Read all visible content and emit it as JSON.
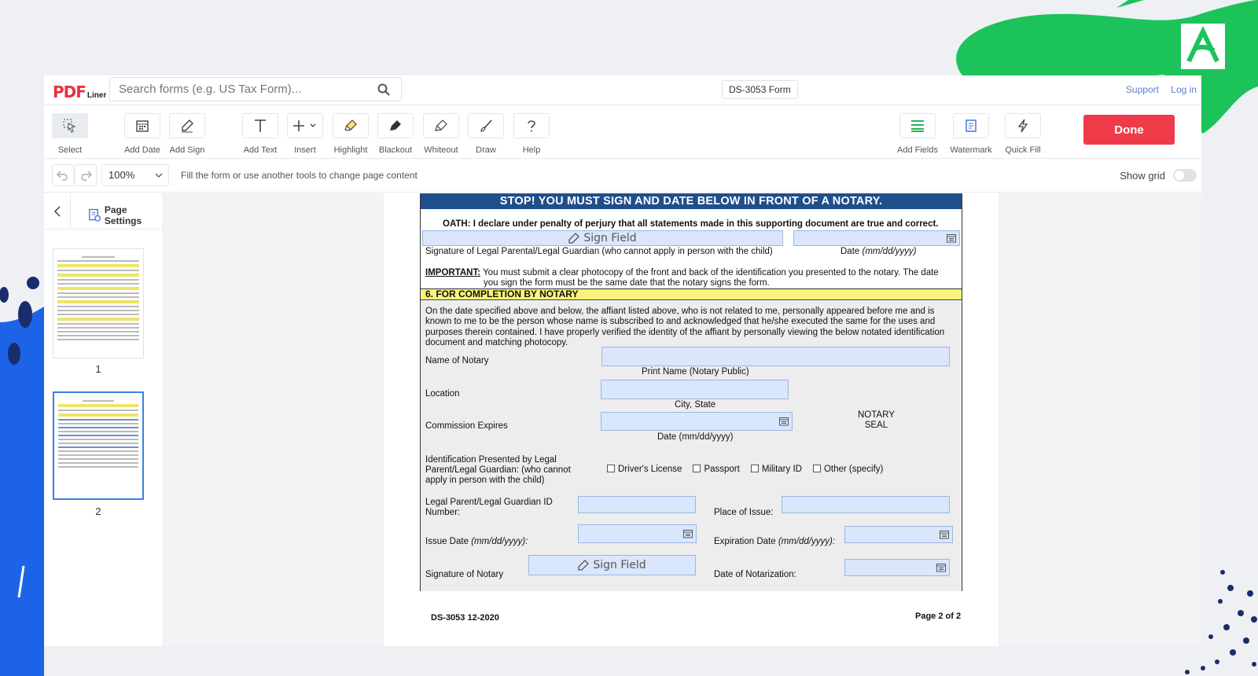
{
  "header": {
    "logo_main": "PDF",
    "logo_sub": "Liner",
    "search_placeholder": "Search forms (e.g. US Tax Form)...",
    "form_name": "DS-3053 Form",
    "support": "Support",
    "login": "Log in"
  },
  "toolbar": {
    "tools": [
      {
        "label": "Select",
        "icon": "cursor-select-icon"
      },
      {
        "label": "Add Date",
        "icon": "calendar-icon"
      },
      {
        "label": "Add Sign",
        "icon": "pen-sign-icon"
      },
      {
        "label": "Add Text",
        "icon": "text-icon"
      },
      {
        "label": "Insert",
        "icon": "plus-icon"
      },
      {
        "label": "Highlight",
        "icon": "highlighter-icon"
      },
      {
        "label": "Blackout",
        "icon": "blackout-icon"
      },
      {
        "label": "Whiteout",
        "icon": "eraser-icon"
      },
      {
        "label": "Draw",
        "icon": "brush-icon"
      },
      {
        "label": "Help",
        "icon": "question-icon"
      },
      {
        "label": "Add Fields",
        "icon": "fields-icon"
      },
      {
        "label": "Watermark",
        "icon": "watermark-icon"
      },
      {
        "label": "Quick Fill",
        "icon": "lightning-icon"
      }
    ],
    "done_label": "Done"
  },
  "subbar": {
    "zoom": "100%",
    "hint": "Fill the form or use another tools to change page content",
    "show_grid": "Show grid",
    "show_grid_on": false
  },
  "sidebar": {
    "page_settings": "Page Settings",
    "pages": [
      "1",
      "2"
    ],
    "selected_page": "2"
  },
  "form": {
    "stop_banner": "STOP! YOU MUST SIGN AND DATE BELOW IN FRONT OF A NOTARY.",
    "oath": "OATH: I declare under penalty of perjury that all statements made in this supporting document are true and correct.",
    "sign_field": "Sign Field",
    "sig_guardian_label": "Signature of Legal Parental/Legal Guardian (who cannot apply in person with the child)",
    "date_label": "Date",
    "date_format": "(mm/dd/yyyy)",
    "important_label": "IMPORTANT:",
    "important_text": "You must submit a clear photocopy of the front and back of the identification you presented to the notary. The date",
    "important_text2": "you sign the form must be the same date that the notary signs the form.",
    "section6": "6. FOR COMPLETION BY NOTARY",
    "para": "On the date specified above and below, the affiant listed above, who is not related to me, personally appeared before me and is known to me to be the person whose name is subscribed to and acknowledged that he/she executed the same for the uses and purposes therein contained. I have properly verified the identity of the affiant by personally viewing the below notated identification document and matching photocopy.",
    "name_of_notary": "Name of Notary",
    "print_name": "Print Name (Notary Public)",
    "location": "Location",
    "city_state": "City, State",
    "commission_expires": "Commission Expires",
    "date_mmddyyyy": "Date (mm/dd/yyyy)",
    "notary_seal_1": "NOTARY",
    "notary_seal_2": "SEAL",
    "id_presented": "Identification Presented by Legal Parent/Legal Guardian: (who cannot apply in person with the child)",
    "id_options": [
      "Driver's License",
      "Passport",
      "Military ID",
      "Other (specify)"
    ],
    "id_number_label": "Legal Parent/Legal Guardian ID Number:",
    "place_of_issue": "Place of Issue:",
    "issue_date": "Issue Date",
    "issue_date_fmt": "(mm/dd/yyyy):",
    "expiration_date": "Expiration Date",
    "expiration_date_fmt": "(mm/dd/yyyy):",
    "signature_of_notary": "Signature of Notary",
    "date_of_notarization": "Date of Notarization:",
    "footer_left": "DS-3053 12-2020",
    "footer_right": "Page 2 of 2"
  },
  "colors": {
    "accent_red": "#ef3b49",
    "field_blue": "#d9e6fb",
    "banner_blue": "#1f4e8c",
    "section_yellow": "#fbf37a",
    "deco_green": "#1cc35a",
    "deco_blue": "#1d63e8"
  }
}
